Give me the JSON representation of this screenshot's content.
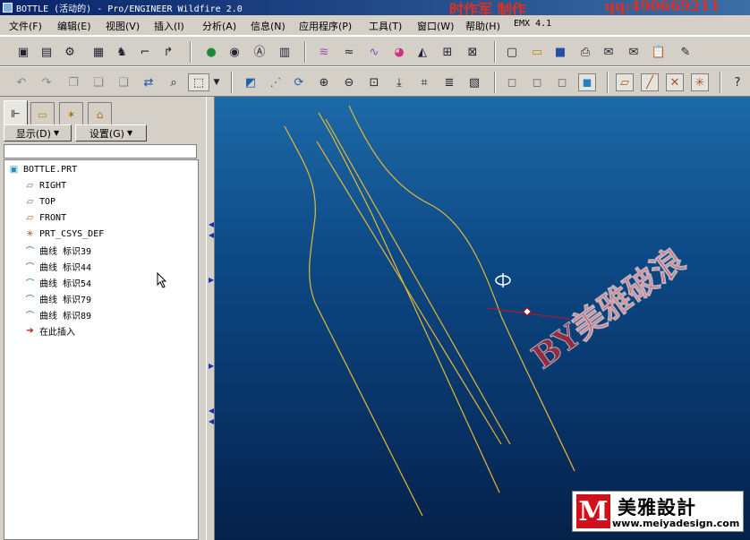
{
  "window": {
    "title": "BOTTLE (活动的) - Pro/ENGINEER Wildfire 2.0",
    "watermark_left": "时作军 制作",
    "watermark_right": "qq:490669211"
  },
  "menu": [
    {
      "id": "file",
      "label": "文件(F)"
    },
    {
      "id": "edit",
      "label": "编辑(E)"
    },
    {
      "id": "view",
      "label": "视图(V)"
    },
    {
      "id": "insert",
      "label": "插入(I)"
    },
    {
      "id": "analysis",
      "label": "分析(A)"
    },
    {
      "id": "info",
      "label": "信息(N)"
    },
    {
      "id": "applications",
      "label": "应用程序(P)"
    },
    {
      "id": "tools",
      "label": "工具(T)"
    },
    {
      "id": "window",
      "label": "窗口(W)"
    },
    {
      "id": "help",
      "label": "帮助(H)"
    },
    {
      "id": "emx",
      "label": "EMX 4.1"
    }
  ],
  "panel": {
    "display_button": "显示(D)",
    "settings_button": "设置(G)"
  },
  "tree": [
    {
      "id": "root",
      "label": "BOTTLE.PRT",
      "icon": "part-icon"
    },
    {
      "id": "right",
      "label": "RIGHT",
      "icon": "datum-plane-icon"
    },
    {
      "id": "top",
      "label": "TOP",
      "icon": "datum-plane-icon"
    },
    {
      "id": "front",
      "label": "FRONT",
      "icon": "datum-plane-icon"
    },
    {
      "id": "csys",
      "label": "PRT_CSYS_DEF",
      "icon": "coordinate-system-icon"
    },
    {
      "id": "curve39",
      "label": "曲线 标识39",
      "icon": "curve-icon"
    },
    {
      "id": "curve44",
      "label": "曲线 标识44",
      "icon": "curve-icon"
    },
    {
      "id": "curve54",
      "label": "曲线 标识54",
      "icon": "curve-icon"
    },
    {
      "id": "curve79",
      "label": "曲线 标识79",
      "icon": "curve-icon"
    },
    {
      "id": "curve89",
      "label": "曲线 标识89",
      "icon": "curve-icon"
    },
    {
      "id": "insert",
      "label": "在此插入",
      "icon": "insert-arrow-icon"
    }
  ],
  "overlays": {
    "brand": "美雅設計",
    "brand_url": "www.meiyadesign.com",
    "stamp": "BY美雅破浪"
  },
  "colors": {
    "curve": "#e8b830",
    "title_bar": "#0a246a",
    "viewport_top": "#1d6aa8",
    "viewport_bottom": "#05214a"
  }
}
